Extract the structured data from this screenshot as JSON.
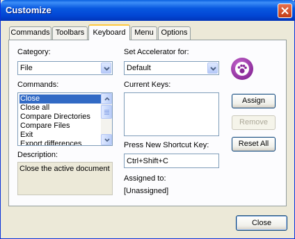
{
  "window": {
    "title": "Customize"
  },
  "tabs": [
    {
      "label": "Commands"
    },
    {
      "label": "Toolbars"
    },
    {
      "label": "Keyboard"
    },
    {
      "label": "Menu"
    },
    {
      "label": "Options"
    }
  ],
  "keyboard": {
    "category_label": "Category:",
    "category_value": "File",
    "accelerator_label": "Set Accelerator for:",
    "accelerator_value": "Default",
    "commands_label": "Commands:",
    "commands": [
      "Close",
      "Close all",
      "Compare Directories",
      "Compare Files",
      "Exit",
      "Export differences"
    ],
    "selected_command": "Close",
    "current_keys_label": "Current Keys:",
    "description_label": "Description:",
    "description_text": "Close the active document",
    "shortcut_label": "Press New Shortcut Key:",
    "shortcut_value": "Ctrl+Shift+C",
    "assigned_label": "Assigned to:",
    "assigned_value": "[Unassigned]",
    "assign_button": "Assign",
    "remove_button": "Remove",
    "reset_button": "Reset All"
  },
  "footer": {
    "close_button": "Close"
  },
  "icons": {
    "app_logo": "paw-print-icon",
    "accent": "#8a2a99"
  }
}
